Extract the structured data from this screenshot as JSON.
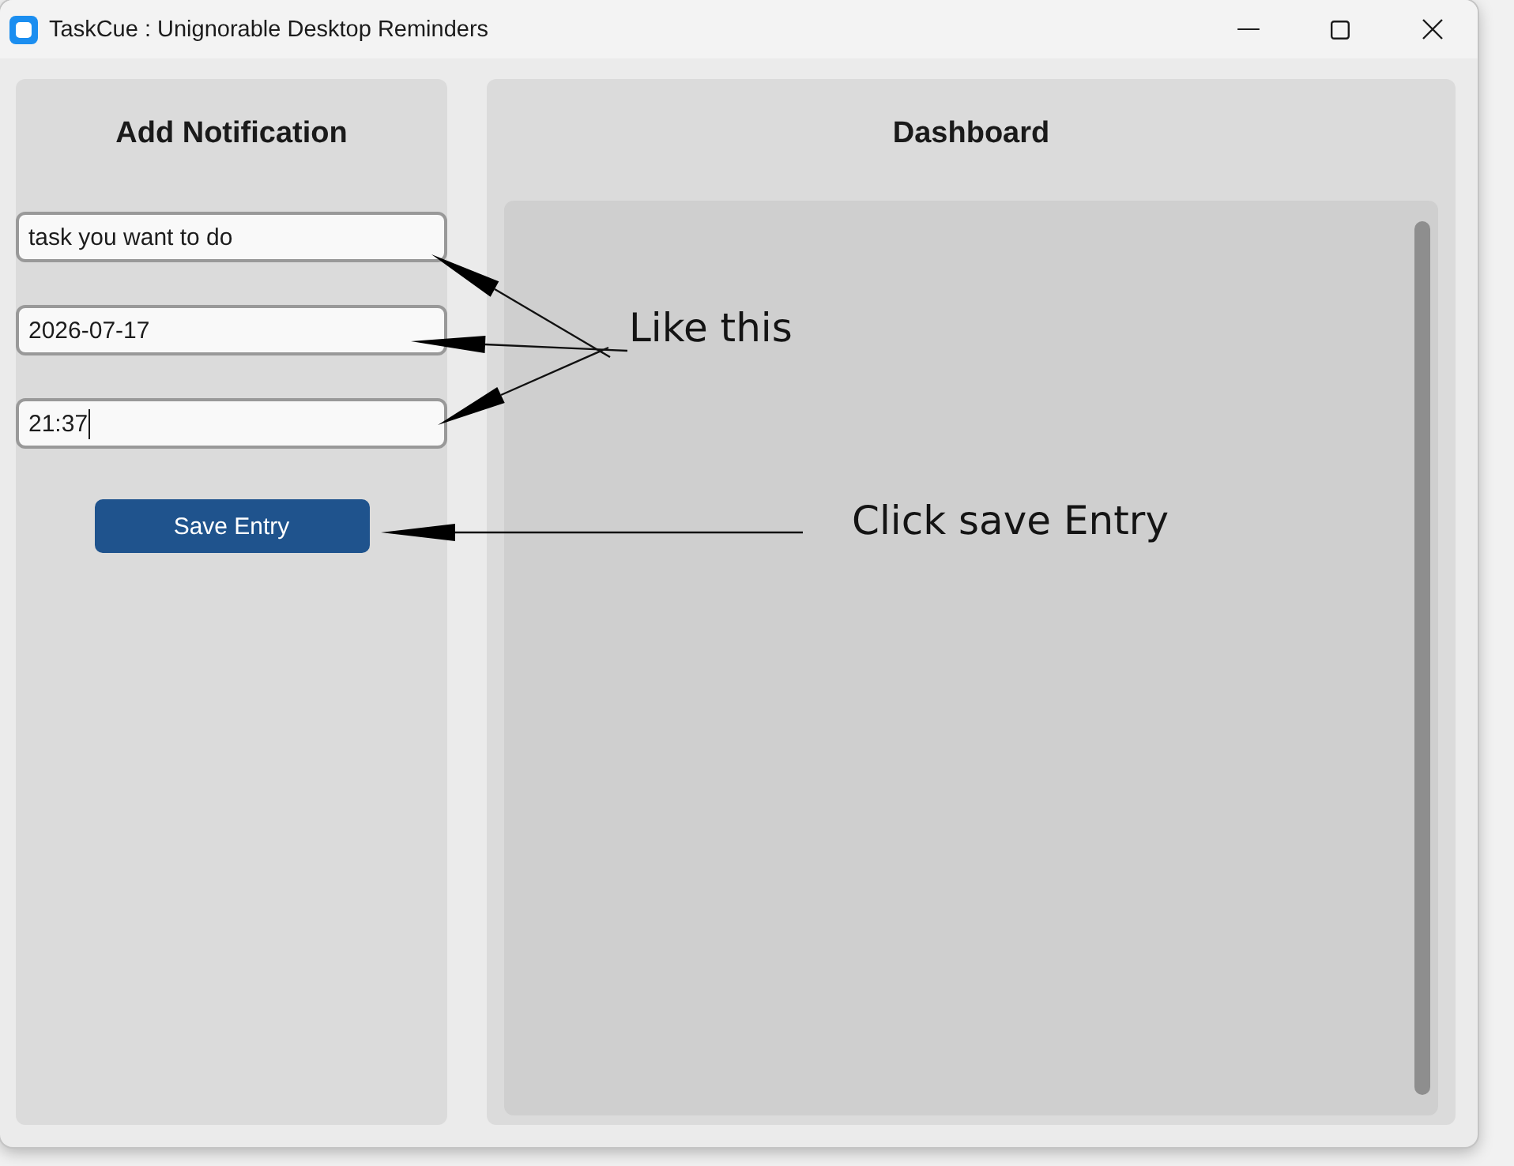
{
  "window": {
    "title": "TaskCue : Unignorable Desktop Reminders"
  },
  "add_panel": {
    "title": "Add Notification",
    "fields": [
      {
        "value": "task you want to do",
        "focused": false
      },
      {
        "value": "2026-07-17",
        "focused": false
      },
      {
        "value": "21:37",
        "focused": true
      }
    ],
    "save_button": "Save Entry"
  },
  "dashboard": {
    "title": "Dashboard"
  },
  "annotations": [
    {
      "text": "Like this"
    },
    {
      "text": "Click save Entry"
    }
  ]
}
